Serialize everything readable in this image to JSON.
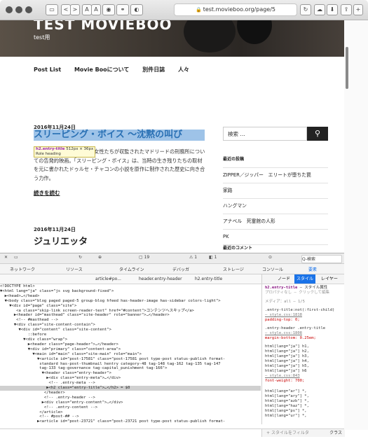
{
  "browser": {
    "url": "test.movieboo.org/page/5",
    "back_label": "<",
    "forward_label": ">",
    "text_small": "A",
    "text_large": "A"
  },
  "site": {
    "title": "TEST MOVIEBOO",
    "tagline": "test用",
    "nav": [
      "Post List",
      "Movie Booについて",
      "別件日誌",
      "人々"
    ]
  },
  "posts": [
    {
      "date": "2016年11月24日",
      "title": "スリーピング・ボイス ～沈黙の叫び",
      "excerpt": "                    乱敗者の家族や恋人である女性たちが収監されたマドリードの刑務所についての告発的映画。「スリーピング・ボイス」は、当時の生き残りたちの取材を元に書かれたドゥルセ・チャコンの小説を原作に制作された歴史に向き合う力作。",
      "read_more": "続きを読む"
    },
    {
      "date": "2016年11月24日",
      "title": "ジュリエッタ"
    }
  ],
  "tooltip": {
    "selector": "h2.entry-title",
    "size": "512px × 36px",
    "role": "Role heading"
  },
  "sidebar": {
    "search_placeholder": "検索 …",
    "recent_heading": "最近の投稿",
    "recent_posts": [
      "ZIPPER／ジッパー　エリートが堕ちた罠",
      "家路",
      "ハングマン",
      "アナベル　死霊館の人形",
      "PK"
    ],
    "comments_heading": "最近のコメント"
  },
  "devtools": {
    "toolbar": [
      "19",
      "1",
      "1"
    ],
    "search_placeholder": "Q-検索",
    "tabs": [
      "ネットワーク",
      "リソース",
      "タイムライン",
      "デバッガ",
      "ストレージ",
      "コンソール",
      "要素"
    ],
    "breadcrumb": [
      "article#po...",
      "header.entry-header",
      "h2.entry-title"
    ],
    "side_tabs": [
      "ノード",
      "スタイル",
      "レイヤー"
    ],
    "dom_lines": [
      "<!DOCTYPE html>",
      "▼<html lang=\"ja\" class=\"js svg background-fixed\">",
      "  ▶<head>…</head>",
      "  ▼<body class=\"blog paged paged-5 group-blog hfeed has-header-image has-sidebar colors-light\">",
      "    ▼<div id=\"page\" class=\"site\">",
      "       <a class=\"skip-link screen-reader-text\" href=\"#content\">コンテンツへスキップ</a>",
      "      ▶<header id=\"masthead\" class=\"site-header\" role=\"banner\">…</header>",
      "       <!-- #masthead -->",
      "      ▼<div class=\"site-content-contain\">",
      "        ▼<div id=\"content\" class=\"site-content\">",
      "            ::before",
      "          ▼<div class=\"wrap\">",
      "            ▶<header class=\"page-header\">…</header>",
      "            ▼<div id=\"primary\" class=\"content-area\">",
      "              ▼<main id=\"main\" class=\"site-main\" role=\"main\">",
      "                ▼<article id=\"post-17581\" class=\"post-17581 post type-post status-publish format-",
      "                 standard has-post-thumbnail hentry category-48 tag-148 tag-162 tag-135 tag-147",
      "                 tag-133 tag-governance tag-capital_punishment tag-166\">",
      "                  ▼<header class=\"entry-header\">",
      "                    ▶<div class=\"entry-meta\">…</div>",
      "                     <!-- .entry-meta -->",
      "                    ▶<h2 class=\"entry-title\">…</h2> = $0",
      "                   </header>",
      "                   <!-- .entry-header -->",
      "                  ▶<div class=\"entry-content\">…</div>",
      "                   <!-- .entry-content -->",
      "                 </article>",
      "                 <!-- #post-## -->",
      "                ▶<article id=\"post-23721\" class=\"post-23721 post type-post status-publish format-"
    ],
    "styles": {
      "selected": "h2.entry-title",
      "selected_note": "— スタイル属性",
      "selected_sub": "プロパティなし — クリックして編集",
      "media": "メディア：all — 1/5",
      "rules": [
        {
          "selector": ".entry-title:not(:first-child)",
          "source": "— style.css:1818",
          "decls": [
            "padding-top: 0;"
          ]
        },
        {
          "selector": ".entry-header .entry-title",
          "source": "— style.css:1808",
          "decls": [
            "margin-bottom: 0.25em;"
          ]
        },
        {
          "selector": "html[lang=\"ja\"] h1, html[lang=\"ja\"] h2, html[lang=\"ja\"] h3, html[lang=\"ja\"] h4, html[lang=\"ja\"] h5, html[lang=\"ja\"] h6",
          "source": "— style.css:843",
          "decls": [
            "font-weight: 700;"
          ]
        },
        {
          "selector": "html[lang=\"ar\"] *, html[lang=\"ary\"] *, html[lang=\"azb\"] *, html[lang=\"haz\"] *, html[lang=\"ps\"] *, html[lang=\"ur\"] *,",
          "source": "",
          "decls": []
        }
      ],
      "filter_placeholder": "スタイルをフィルタ",
      "class_label": "クラス"
    }
  },
  "colors": {
    "selection_bg": "#9ec3e8",
    "title_link": "#2970b4",
    "tag": "#881280"
  }
}
